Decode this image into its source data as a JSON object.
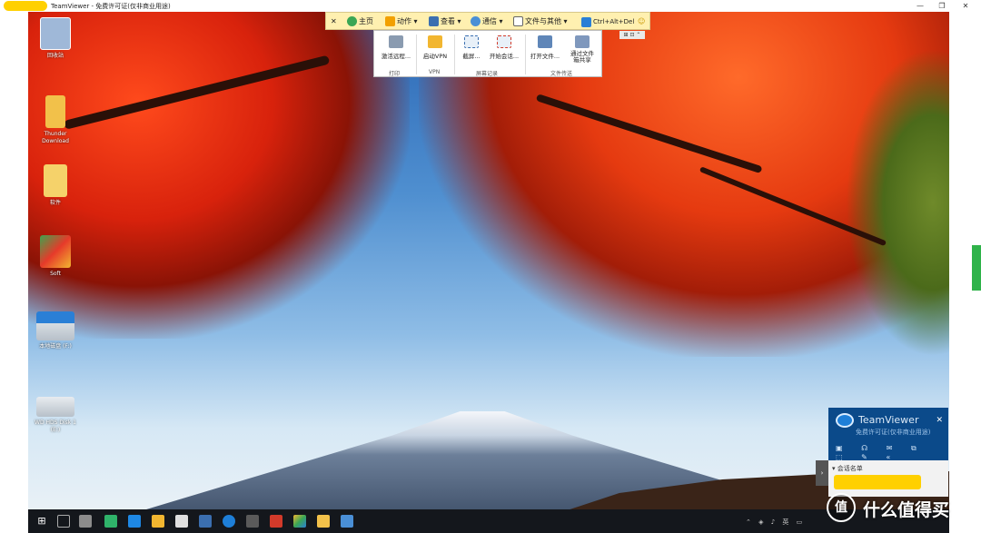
{
  "window": {
    "title": "TeamViewer - 免费许可证(仅非商业用途)",
    "minimize_glyph": "—",
    "restore_glyph": "❐",
    "close_glyph": "✕"
  },
  "remote_toolbar": {
    "items": [
      {
        "label": "主页",
        "icon": "home-icon"
      },
      {
        "label": "动作",
        "icon": "lightning-icon"
      },
      {
        "label": "查看",
        "icon": "monitor-icon"
      },
      {
        "label": "通信",
        "icon": "phone-icon"
      },
      {
        "label": "文件与其他",
        "icon": "file-icon"
      },
      {
        "label": "Ctrl+Alt+Del",
        "icon": "run-icon"
      }
    ],
    "close_glyph": "✕",
    "smile_glyph": "☺"
  },
  "ribbon": {
    "items": [
      {
        "label": "激活远程...",
        "icon": "printer-icon"
      },
      {
        "label": "启动VPN",
        "icon": "vpn-shield-icon"
      },
      {
        "label": "截屏...",
        "icon": "camera-icon"
      },
      {
        "label": "开始会话...",
        "icon": "record-icon"
      },
      {
        "label": "打开文件...",
        "icon": "file-transfer-icon"
      },
      {
        "label": "通过文件\n箱共享",
        "icon": "file-box-icon"
      }
    ],
    "groups": [
      "打印",
      "VPN",
      "屏幕记录",
      "文件传送"
    ],
    "mini_controls": "⊞ ⊡ ⌃"
  },
  "desktop_icons": [
    {
      "label": "回收站",
      "icon": "recycle-bin-icon",
      "color": "#9fb8d8"
    },
    {
      "label": "Thunder\nDownload",
      "icon": "folder-icon",
      "color": "#f2c14a"
    },
    {
      "label": "软件",
      "icon": "folder-icon",
      "color": "#f5d26a"
    },
    {
      "label": "Soft",
      "icon": "app-icon",
      "color": "#e63a2a"
    },
    {
      "label": "本地磁盘 (F:)",
      "icon": "drive-icon",
      "color": "#cfd6dd"
    },
    {
      "label": "WD HDS Disk 1\n(E:)",
      "icon": "drive-icon",
      "color": "#cfd6dd"
    }
  ],
  "teamviewer_panel": {
    "title": "TeamViewer",
    "subtitle": "免费许可证(仅非商业用途)",
    "close_glyph": "✕",
    "icons": "▣ ☊ ✉ ⧉ ⬚ ✎ «",
    "session_header": "▾ 会话名单"
  },
  "taskbar": {
    "start_glyph": "⊞",
    "tray_text": "⌃ ◈ ♪ 英 ▭"
  },
  "watermark": {
    "circle_glyph": "值",
    "text": "什么值得买"
  },
  "colors": {
    "toolbar_bg": "#fff0b0",
    "panel_bg": "#0b4a8a",
    "taskbar_bg": "#14171c",
    "redaction": "#ffd000"
  }
}
